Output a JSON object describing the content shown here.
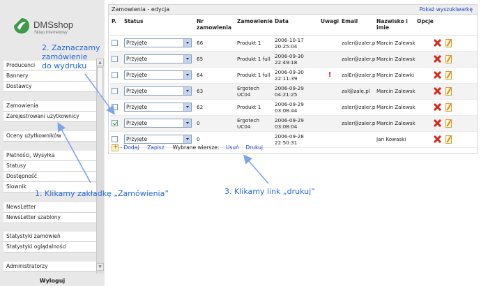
{
  "brand": {
    "name": "DMSshop",
    "tagline": "Sklep Internetowy"
  },
  "sidebar": {
    "items": [
      "Producenci",
      "Bannery",
      "Dostawcy",
      "Zamowienia",
      "Zarejestrowani uzytkownicy",
      "Oceny użytkowników",
      "Płatności, Wysyłka",
      "Statusy",
      "Dostępność",
      "Slownik",
      "NewsLetter",
      "NewsLetter szablony",
      "Statystyki zamówień",
      "Statystyki oglądalności",
      "Administratorzy"
    ],
    "logout": "Wyloguj"
  },
  "panel": {
    "title": "Zamowienia - edycja",
    "show_search": "Pokaż wyszukiwarkę",
    "columns": [
      "P.",
      "Status",
      "Nr zamowienia",
      "Zamowienie",
      "Data",
      "Uwagi",
      "Email",
      "Nazwisko i imie",
      "Opcje"
    ],
    "rows": [
      {
        "checked": false,
        "status": "Przyjęte",
        "nr": "66",
        "product": "Produkt 1",
        "date1": "2006-10-17",
        "date2": "20:25:04",
        "note": "",
        "email": "zaler@zaler.pl",
        "name": "Marcin Zalewski"
      },
      {
        "checked": false,
        "status": "Przyjęte",
        "nr": "65",
        "product": "Produkt 1 full",
        "date1": "2006-09-30",
        "date2": "22:49:18",
        "note": "",
        "email": "zaler@zaler.pl",
        "name": "Marcin Zalewski"
      },
      {
        "checked": false,
        "status": "Przyjęte",
        "nr": "64",
        "product": "Produkt 1 full",
        "date1": "2006-09-30",
        "date2": "22:11:39",
        "note": "!",
        "email": "zalEr@zaler.pl",
        "name": "Marcin Zalewki"
      },
      {
        "checked": false,
        "status": "Przyjęte",
        "nr": "63",
        "product": "Ergotech UC04",
        "date1": "2006-09-29",
        "date2": "04:21:25",
        "note": "",
        "email": "zal@zale.pl",
        "name": "Marcin Zalewski"
      },
      {
        "checked": false,
        "status": "Przyjęte",
        "nr": "62",
        "product": "Produkt 1",
        "date1": "2006-09-29",
        "date2": "03:08:44",
        "note": "",
        "email": "zaler@zaler.pl",
        "name": "Marcin Zalewski"
      },
      {
        "checked": true,
        "status": "Przyjęte",
        "nr": "0",
        "product": "Ergotech UC04",
        "date1": "2006-09-29",
        "date2": "03:08:04",
        "note": "",
        "email": "zaler@zaler.pl",
        "name": "Marcin Zalewski"
      },
      {
        "checked": false,
        "status": "Przyjęte",
        "nr": "0",
        "product": "",
        "date1": "2006-09-28",
        "date2": "22:50:31",
        "note": "",
        "email": "",
        "name": "Jan Kowaski"
      }
    ],
    "actions": {
      "add": "- Dodaj",
      "save": "Zapisz",
      "selected_label": "Wybrane wiersze:",
      "delete": "Usuń",
      "print": "Drukuj"
    }
  },
  "annotations": {
    "step1": "1. Klikamy zakładkę „Zamówienia”",
    "step2_line1": "2. Zaznaczamy",
    "step2_line2": "zamówienie",
    "step2_line3": "do wydruku",
    "step3": "3. Klikamy link „drukuj”"
  },
  "colors": {
    "annotation": "#2266dd",
    "link": "#1a44c8",
    "delete": "#d42a1a",
    "warning": "#e21a1a"
  }
}
